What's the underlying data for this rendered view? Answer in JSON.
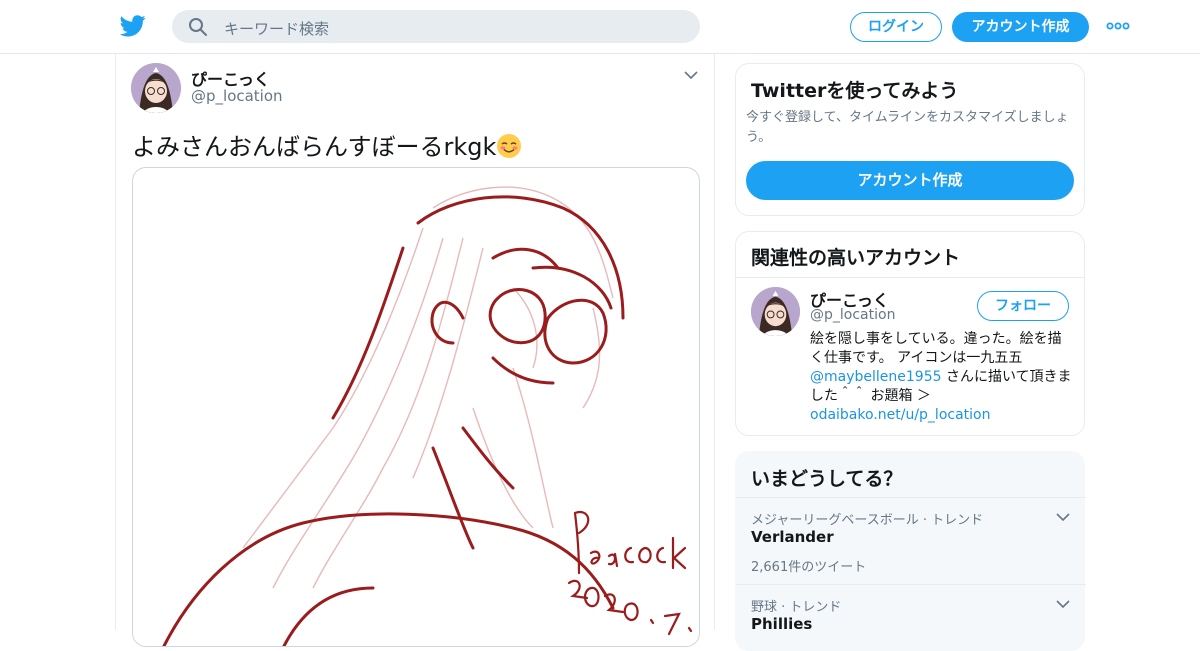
{
  "topbar": {
    "search_placeholder": "キーワード検索",
    "login_label": "ログイン",
    "signup_label": "アカウント作成"
  },
  "tweet": {
    "author_name": "ぴーこっく",
    "author_handle": "@p_location",
    "text": "よみさんおんばらんすぼーるrkgk",
    "emoji_icon": "smiling-face-icon",
    "media_alt_icon": "sketch-illustration"
  },
  "signup_card": {
    "title": "Twitterを使ってみよう",
    "description": "今すぐ登録して、タイムラインをカスタマイズしましょう。",
    "button_label": "アカウント作成"
  },
  "related_card": {
    "title": "関連性の高いアカウント",
    "name": "ぴーこっく",
    "handle": "@p_location",
    "follow_label": "フォロー",
    "bio_text_1": "絵を隠し事をしている。違った。絵を描く仕事です。 アイコンは一九五五",
    "bio_link_1": "@maybellene1955",
    "bio_text_2": " さんに描いて頂きました＾＾ お題箱 ＞",
    "bio_link_2": "odaibako.net/u/p_location"
  },
  "trends_card": {
    "title": "いまどうしてる？",
    "items": [
      {
        "meta": "メジャーリーグベースボール · トレンド",
        "name": "Verlander",
        "count": "2,661件のツイート"
      },
      {
        "meta": "野球 · トレンド",
        "name": "Phillies",
        "count": ""
      }
    ]
  },
  "colors": {
    "accent": "#1da1f2",
    "link": "#1b95e0",
    "sketch": "#9b1c1c"
  }
}
